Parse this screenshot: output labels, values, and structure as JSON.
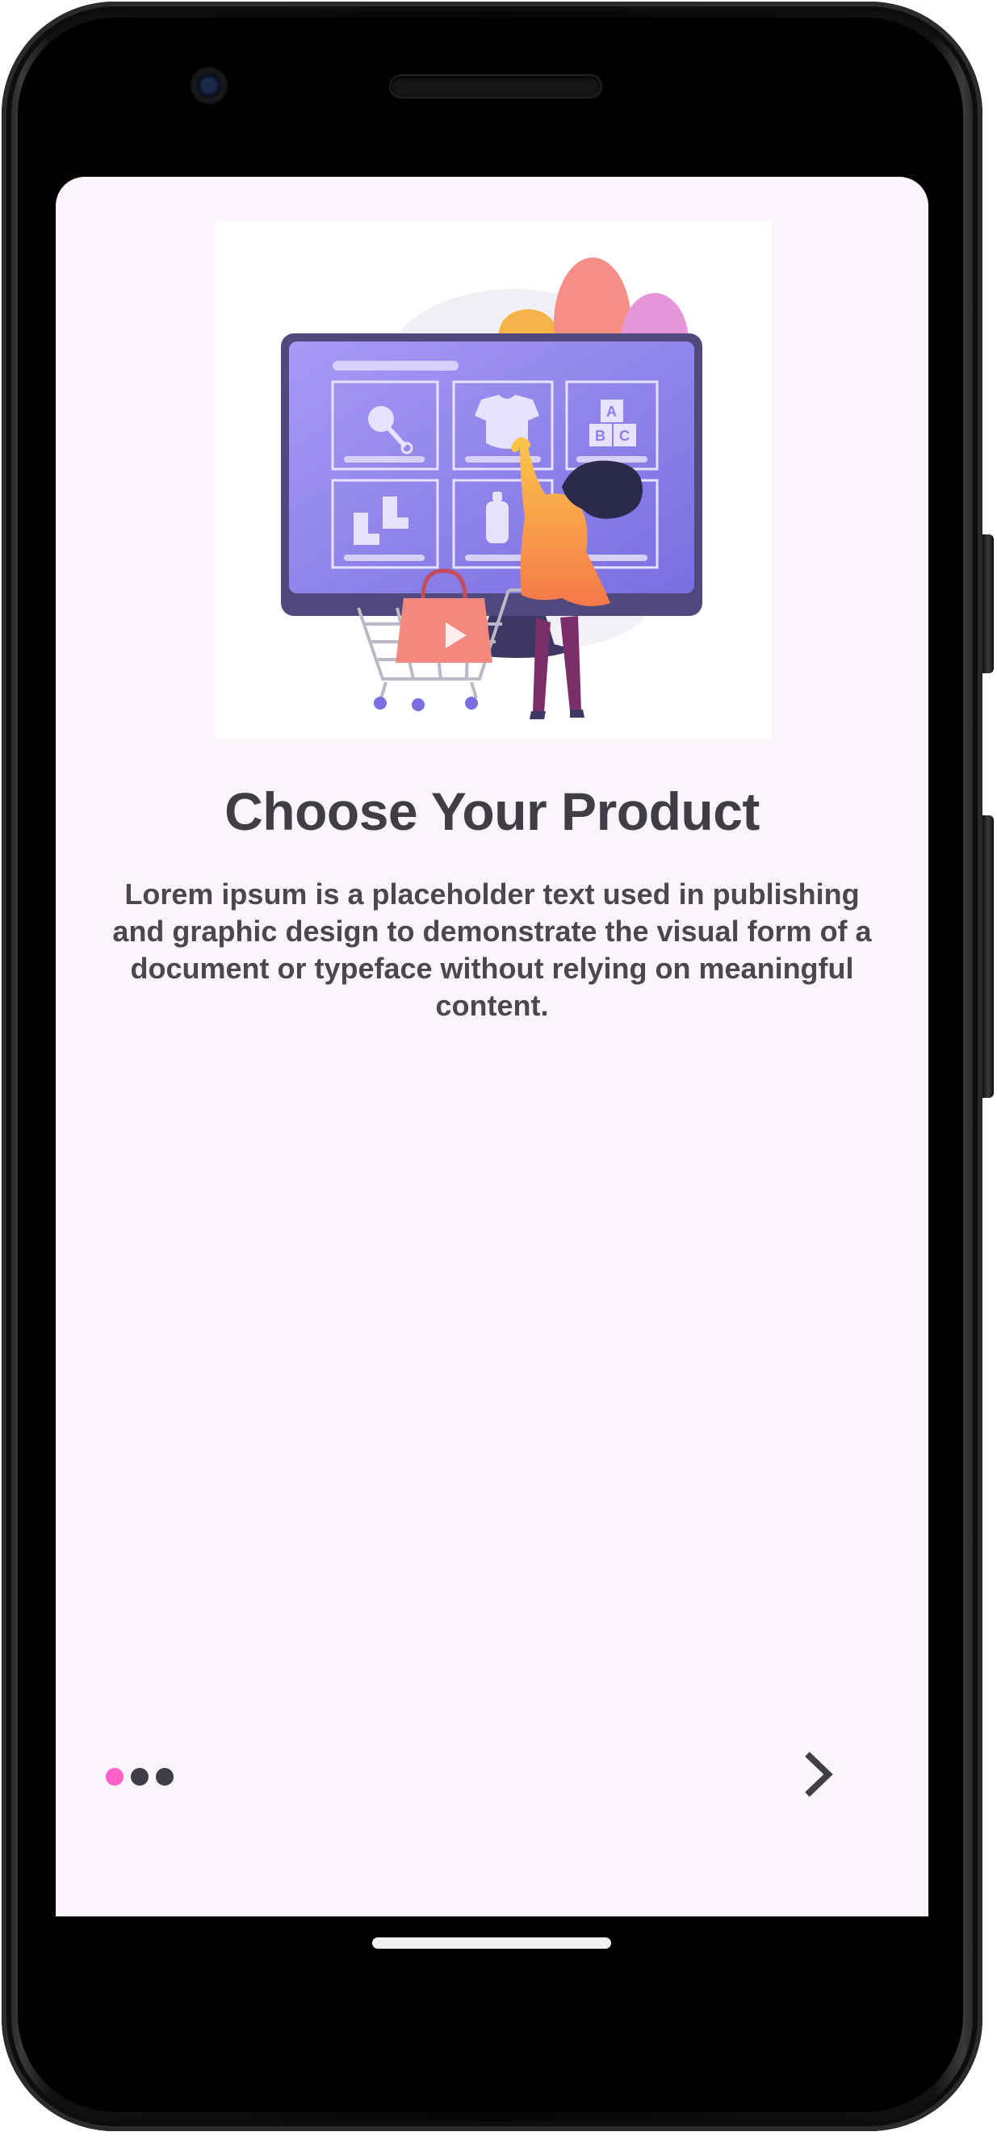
{
  "onboarding": {
    "title": "Choose Your Product",
    "description": "Lorem ipsum is a placeholder text used in publishing and graphic design to demonstrate the visual form of a document or typeface without relying on meaningful content.",
    "illustration_icon": "online-shopping-illustration",
    "illustration_letters": [
      "A",
      "B",
      "C"
    ],
    "page_indicator": {
      "total": 3,
      "current": 1,
      "active_color": "#ff5fc8",
      "inactive_color": "#3f3d45"
    },
    "next_icon": "chevron-right-icon"
  },
  "colors": {
    "screen_background": "#fbf5fb",
    "text_primary": "#3f3d45",
    "accent": "#ff5fc8"
  }
}
